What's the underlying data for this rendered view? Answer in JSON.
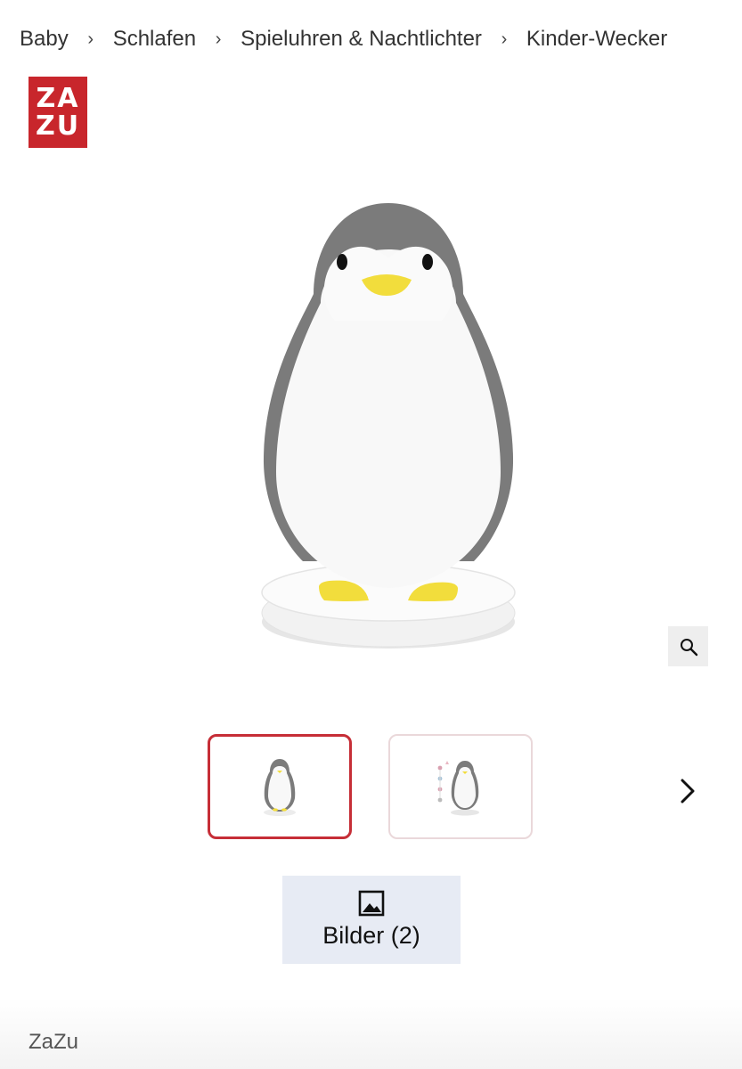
{
  "breadcrumb": {
    "items": [
      "Baby",
      "Schlafen",
      "Spieluhren & Nachtlichter",
      "Kinder-Wecker"
    ],
    "separator": "›"
  },
  "logo": {
    "line1": "ZA",
    "line2": "ZU",
    "color": "#c8262c"
  },
  "product_image": {
    "subject": "penguin-nightlight",
    "accent": "#f2dd3c",
    "body_grey": "#7b7b7b"
  },
  "zoom": {
    "icon": "magnifier-icon"
  },
  "thumbnails": [
    {
      "selected": true,
      "border_color": "#c62e37"
    },
    {
      "selected": false,
      "border_color": "#ead8da"
    }
  ],
  "carousel": {
    "next_icon": "chevron-right-icon"
  },
  "gallery": {
    "label": "Bilder (2)",
    "icon": "image-icon",
    "background": "#e7ebf4"
  },
  "brand": {
    "name": "ZaZu"
  }
}
